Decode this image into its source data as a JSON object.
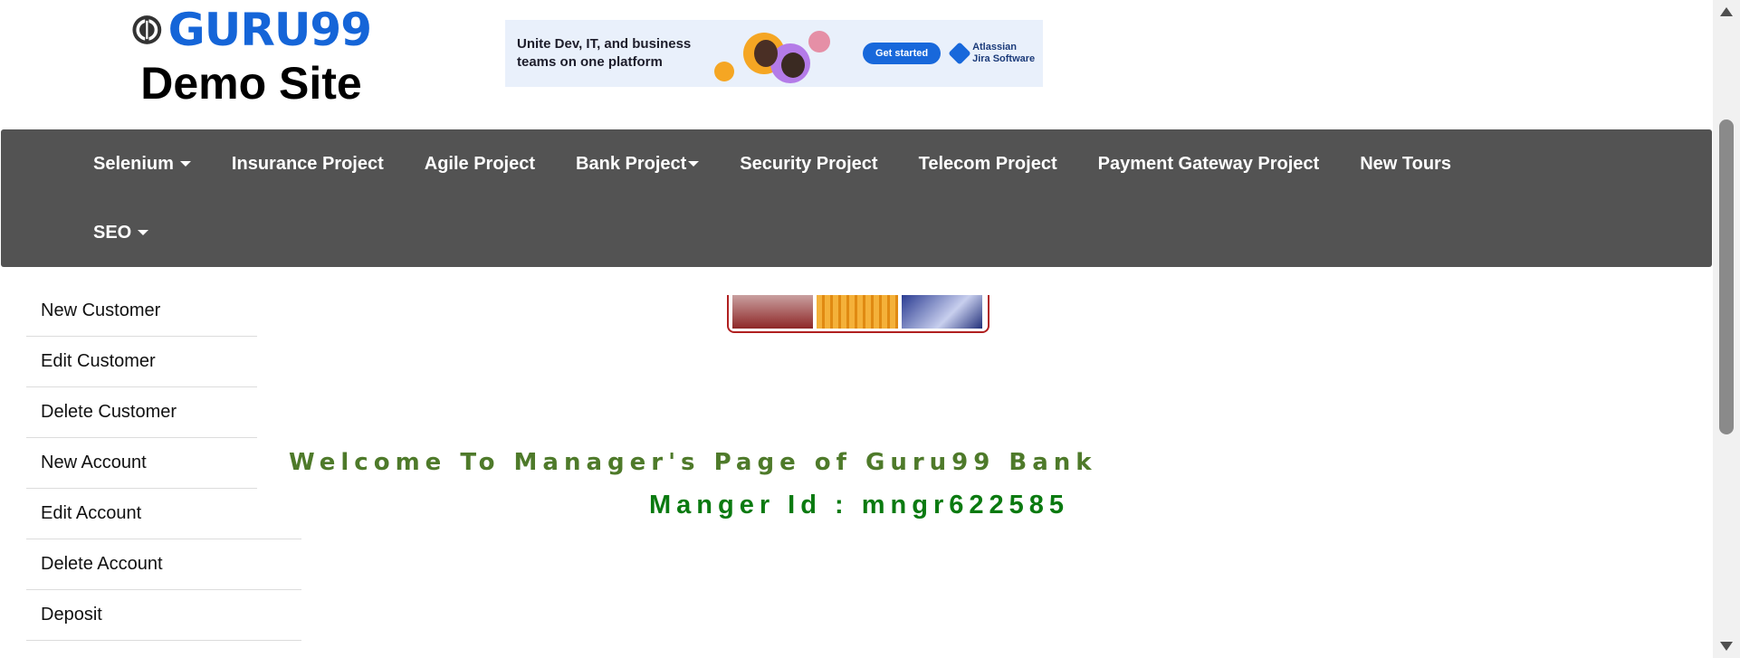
{
  "header": {
    "logo_text": "GURU99",
    "site_title": "Demo Site"
  },
  "ad": {
    "text": "Unite Dev, IT, and business teams on one platform",
    "cta": "Get started",
    "brand_line1": "Atlassian",
    "brand_line2": "Jira Software"
  },
  "nav": {
    "row1": [
      {
        "label": "Selenium",
        "dropdown": true
      },
      {
        "label": "Insurance Project",
        "dropdown": false
      },
      {
        "label": "Agile Project",
        "dropdown": false
      },
      {
        "label": "Bank Project",
        "dropdown": true
      },
      {
        "label": "Security Project",
        "dropdown": false
      },
      {
        "label": "Telecom Project",
        "dropdown": false
      },
      {
        "label": "Payment Gateway Project",
        "dropdown": false
      },
      {
        "label": "New Tours",
        "dropdown": false
      }
    ],
    "row2": [
      {
        "label": "SEO",
        "dropdown": true
      }
    ]
  },
  "sidebar": {
    "items": [
      {
        "label": "New Customer"
      },
      {
        "label": "Edit Customer"
      },
      {
        "label": "Delete Customer"
      },
      {
        "label": "New Account"
      },
      {
        "label": "Edit Account"
      },
      {
        "label": "Delete Account"
      },
      {
        "label": "Deposit"
      }
    ]
  },
  "main": {
    "welcome": "Welcome To Manager's Page of Guru99 Bank",
    "manager_id": "Manger Id : mngr622585"
  },
  "colors": {
    "logo_blue": "#1565d8",
    "navbar_bg": "#535353",
    "welcome_green": "#4e7a2a",
    "manager_id_green": "#0a7a10"
  }
}
